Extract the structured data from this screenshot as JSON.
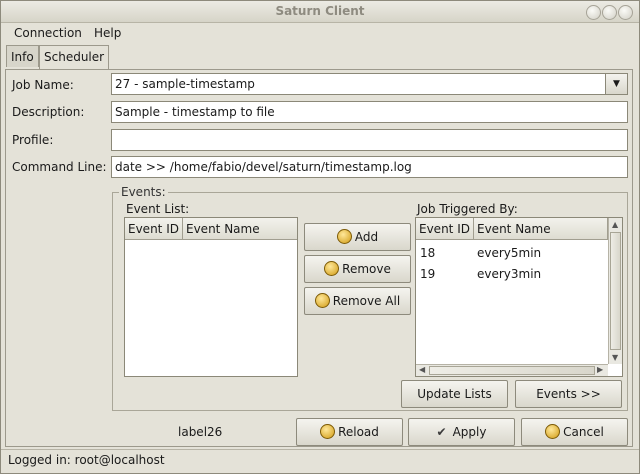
{
  "window": {
    "title": "Saturn Client"
  },
  "menubar": {
    "connection": "Connection",
    "help": "Help"
  },
  "tabs": [
    {
      "label": "Info"
    },
    {
      "label": "Scheduler"
    }
  ],
  "form": {
    "job_name_label": "Job Name:",
    "job_name_value": "27 - sample-timestamp",
    "description_label": "Description:",
    "description_value": "Sample - timestamp to file",
    "profile_label": "Profile:",
    "profile_value": "",
    "command_line_label": "Command Line:",
    "command_line_value": "date >> /home/fabio/devel/saturn/timestamp.log"
  },
  "events": {
    "frame_title": "Events:",
    "event_list_label": "Event List:",
    "event_list_columns": [
      "Event ID",
      "Event Name"
    ],
    "triggered_label": "Job Triggered By:",
    "triggered_columns": [
      "Event ID",
      "Event Name"
    ],
    "triggered_rows": [
      {
        "id": "18",
        "name": "every5min"
      },
      {
        "id": "19",
        "name": "every3min"
      }
    ],
    "add_label": "Add",
    "remove_label": "Remove",
    "remove_all_label": "Remove All",
    "update_lists_label": "Update Lists",
    "events_more_label": "Events >>"
  },
  "footer": {
    "label26": "label26",
    "reload_label": "Reload",
    "apply_label": "Apply",
    "cancel_label": "Cancel"
  },
  "status": {
    "text": "Logged in: root@localhost"
  },
  "colors": {
    "window_bg": "#e4e2d8",
    "button_icon": "#d19b14"
  },
  "icons": [
    "close-icon",
    "minimize-icon",
    "maximize-icon",
    "dropdown-arrow-icon",
    "add-icon",
    "remove-icon",
    "remove-all-icon",
    "reload-icon",
    "apply-check-icon",
    "cancel-icon"
  ]
}
